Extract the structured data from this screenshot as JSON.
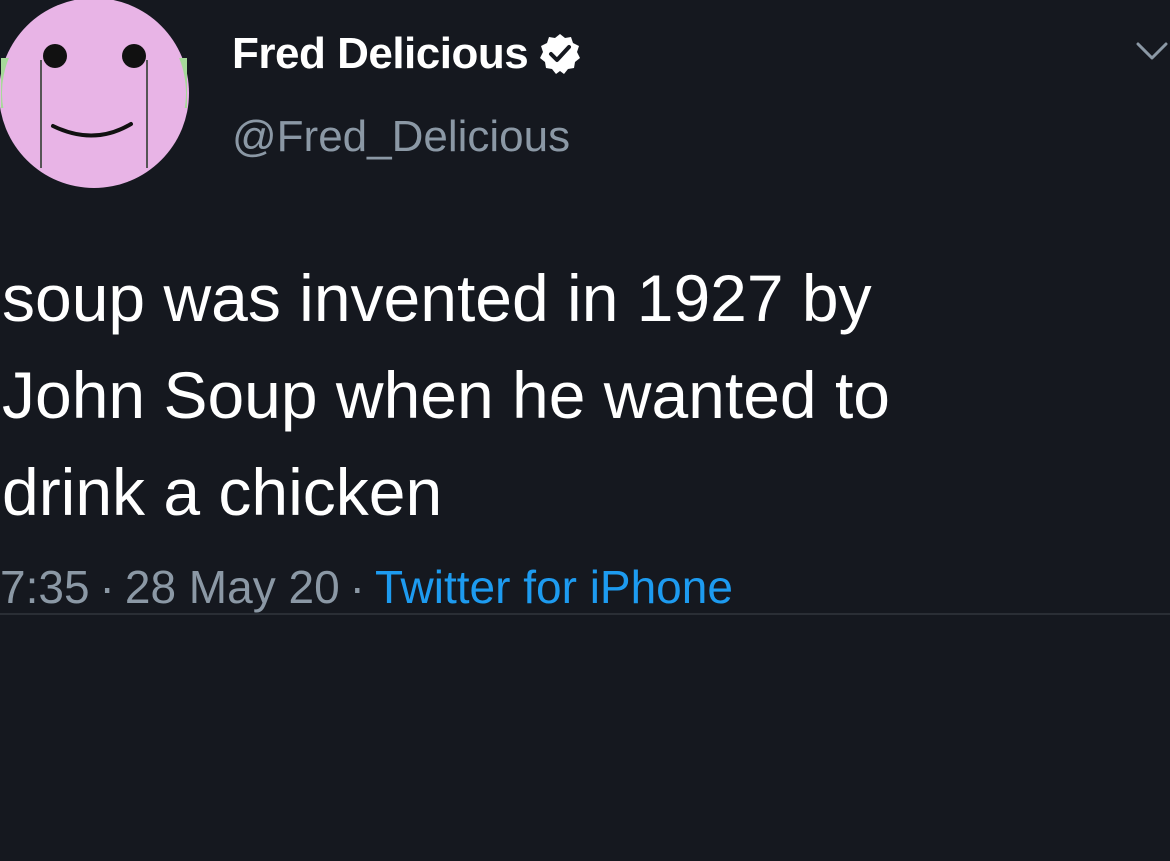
{
  "tweet": {
    "author": {
      "display_name": "Fred Delicious",
      "handle": "@Fred_Delicious",
      "verified": true
    },
    "text": "soup was invented in 1927 by\nJohn Soup when he wanted to\ndrink a chicken",
    "meta": {
      "time": "7:35",
      "separator": "·",
      "date": "28 May 20",
      "source": "Twitter for iPhone"
    }
  },
  "colors": {
    "background": "#15181f",
    "text_primary": "#ffffff",
    "text_secondary": "#8b98a5",
    "accent": "#1d9bf0",
    "avatar_fill": "#e8b4e6"
  },
  "icons": {
    "verified": "verified-badge-icon",
    "menu": "chevron-down-icon",
    "avatar": "smiley-face-avatar"
  }
}
